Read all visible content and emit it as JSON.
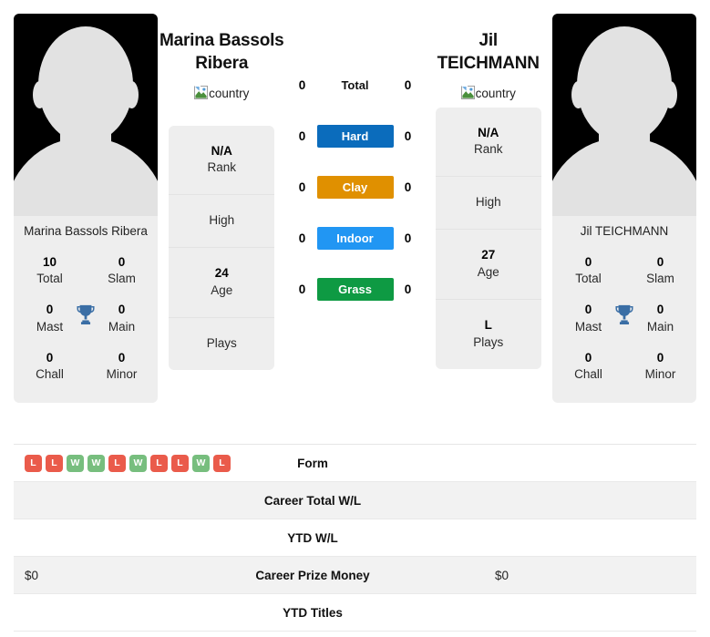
{
  "players": {
    "left": {
      "display_name": "Marina Bassols Ribera",
      "name_line1": "Marina Bassols",
      "name_line2": "Ribera",
      "flag_alt": "country",
      "titles": {
        "total_value": "10",
        "total_label": "Total",
        "slam_value": "0",
        "slam_label": "Slam",
        "mast_value": "0",
        "mast_label": "Mast",
        "main_value": "0",
        "main_label": "Main",
        "chall_value": "0",
        "chall_label": "Chall",
        "minor_value": "0",
        "minor_label": "Minor"
      },
      "bio": {
        "rank_value": "N/A",
        "rank_label": "Rank",
        "high_value": "",
        "high_label": "High",
        "age_value": "24",
        "age_label": "Age",
        "plays_value": "",
        "plays_label": "Plays"
      },
      "stats": {
        "career_total_wl": "",
        "ytd_wl": "",
        "career_prize_money": "$0",
        "ytd_titles": ""
      }
    },
    "right": {
      "display_name": "Jil TEICHMANN",
      "name_line1": "Jil",
      "name_line2": "TEICHMANN",
      "flag_alt": "country",
      "titles": {
        "total_value": "0",
        "total_label": "Total",
        "slam_value": "0",
        "slam_label": "Slam",
        "mast_value": "0",
        "mast_label": "Mast",
        "main_value": "0",
        "main_label": "Main",
        "chall_value": "0",
        "chall_label": "Chall",
        "minor_value": "0",
        "minor_label": "Minor"
      },
      "bio": {
        "rank_value": "N/A",
        "rank_label": "Rank",
        "high_value": "",
        "high_label": "High",
        "age_value": "27",
        "age_label": "Age",
        "plays_value": "L",
        "plays_label": "Plays"
      },
      "stats": {
        "career_total_wl": "",
        "ytd_wl": "",
        "career_prize_money": "$0",
        "ytd_titles": ""
      }
    }
  },
  "head_to_head": {
    "rows": [
      {
        "label": "Total",
        "left": "0",
        "right": "0",
        "color": "",
        "plain": true
      },
      {
        "label": "Hard",
        "left": "0",
        "right": "0",
        "color": "#0b6cbc",
        "plain": false
      },
      {
        "label": "Clay",
        "left": "0",
        "right": "0",
        "color": "#e09000",
        "plain": false
      },
      {
        "label": "Indoor",
        "left": "0",
        "right": "0",
        "color": "#2196f3",
        "plain": false
      },
      {
        "label": "Grass",
        "left": "0",
        "right": "0",
        "color": "#0e9a43",
        "plain": false
      }
    ]
  },
  "form": {
    "label": "Form",
    "left_results": [
      "L",
      "L",
      "W",
      "W",
      "L",
      "W",
      "L",
      "L",
      "W",
      "L"
    ],
    "right_results": []
  },
  "stat_rows": {
    "career_total_wl_label": "Career Total W/L",
    "ytd_wl_label": "YTD W/L",
    "career_prize_money_label": "Career Prize Money",
    "ytd_titles_label": "YTD Titles"
  },
  "colors": {
    "hard": "#0b6cbc",
    "clay": "#e09000",
    "indoor": "#2196f3",
    "grass": "#0e9a43",
    "win": "#77be7e",
    "loss": "#ea5b4b",
    "trophy": "#3a6ea5",
    "card_bg": "#eeeeee",
    "row_alt_bg": "#f2f2f2"
  }
}
